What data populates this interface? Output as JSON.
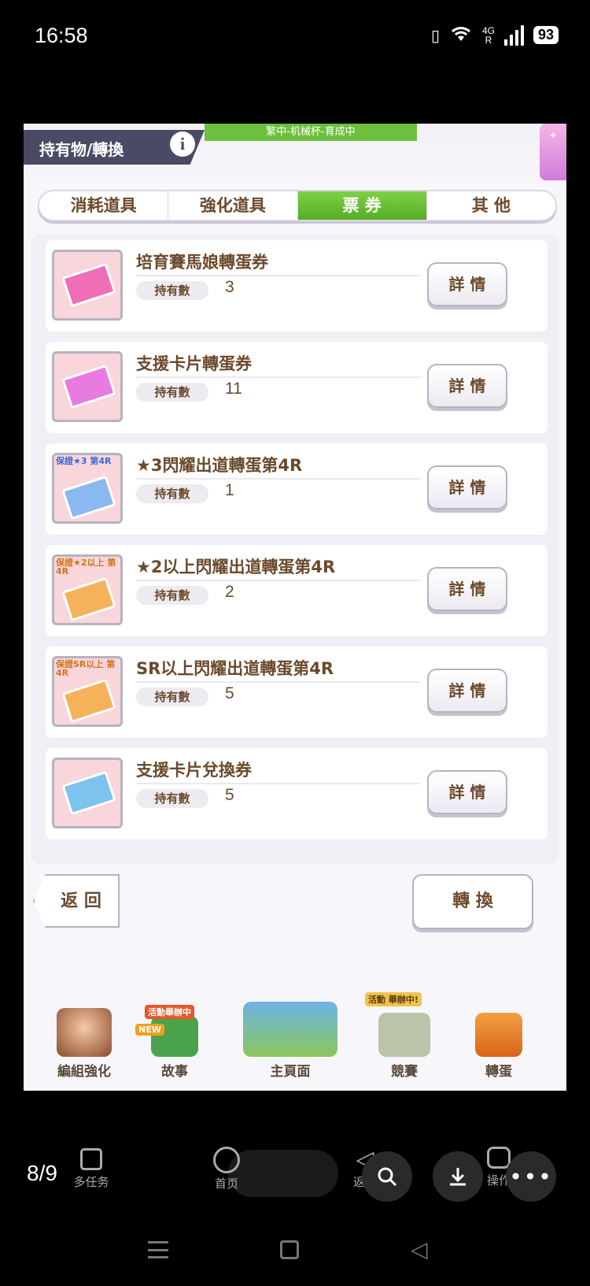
{
  "status_bar": {
    "time": "16:58",
    "network": "4G",
    "roaming": "R",
    "battery": "93"
  },
  "header": {
    "title": "持有物/轉換",
    "info_label": "i",
    "banner": "繁中-机械杯-育成中"
  },
  "tabs": [
    {
      "label": "消耗道具",
      "active": false
    },
    {
      "label": "強化道具",
      "active": false
    },
    {
      "label": "票 券",
      "active": true
    },
    {
      "label": "其 他",
      "active": false
    }
  ],
  "count_label": "持有數",
  "detail_label": "詳 情",
  "items": [
    {
      "name": "培育賽馬娘轉蛋券",
      "count": "3",
      "color": "#ef6fb7",
      "tag": ""
    },
    {
      "name": "支援卡片轉蛋券",
      "count": "11",
      "color": "#e97ae0",
      "tag": ""
    },
    {
      "name": "★3閃耀出道轉蛋第4R",
      "count": "1",
      "color": "#8ab8f0",
      "tag": "保證★3 第4R"
    },
    {
      "name": "★2以上閃耀出道轉蛋第4R",
      "count": "2",
      "color": "#f4b35a",
      "tag": "保證★2以上 第4R"
    },
    {
      "name": "SR以上閃耀出道轉蛋第4R",
      "count": "5",
      "color": "#f4b35a",
      "tag": "保證SR以上 第4R"
    },
    {
      "name": "支援卡片兌換券",
      "count": "5",
      "color": "#7cc3ee",
      "tag": ""
    }
  ],
  "footer": {
    "back_label": "返 回",
    "convert_label": "轉 換"
  },
  "game_nav": [
    {
      "label": "編組強化",
      "badge": ""
    },
    {
      "label": "故事",
      "badge": "活動舉辦中",
      "extra": "NEW"
    },
    {
      "label": "主頁面",
      "badge": ""
    },
    {
      "label": "競賽",
      "badge": "活動 舉辦中!"
    },
    {
      "label": "轉蛋",
      "badge": ""
    }
  ],
  "system_nav": {
    "pager": "8/9",
    "multitask": "多任务",
    "home": "首页",
    "back": "返回",
    "ops": "操作"
  }
}
